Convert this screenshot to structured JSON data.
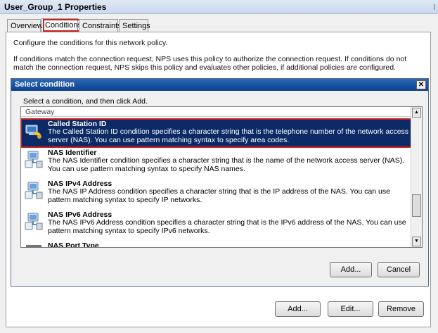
{
  "window": {
    "title": "User_Group_1 Properties",
    "edge_glyph": "⁝"
  },
  "tabs": [
    {
      "label": "Overview",
      "active": false
    },
    {
      "label": "Conditions",
      "active": true
    },
    {
      "label": "Constraints",
      "active": false
    },
    {
      "label": "Settings",
      "active": false
    }
  ],
  "conditions_page": {
    "intro": "Configure the conditions for this network policy.",
    "explanation": "If conditions match the connection request, NPS uses this policy to authorize the connection request. If conditions do not match the connection request, NPS skips this policy and evaluates other policies, if additional policies are configured.",
    "buttons": {
      "add": "Add...",
      "edit": "Edit...",
      "remove": "Remove"
    }
  },
  "dialog": {
    "title": "Select condition",
    "close_glyph": "✕",
    "instruction": "Select a condition, and then click Add.",
    "group_header": "Gateway",
    "items": [
      {
        "title": "Called Station ID",
        "description": "The Called Station ID condition specifies a character string that is the telephone number of the network access server (NAS). You can use pattern matching syntax to specify area codes.",
        "icon": "phone-computer-icon",
        "selected": true
      },
      {
        "title": "NAS Identifier",
        "description": "The NAS Identifier condition specifies a character string that is the name of the network access server (NAS). You can use pattern matching syntax to specify NAS names.",
        "icon": "network-server-icon",
        "selected": false
      },
      {
        "title": "NAS IPv4 Address",
        "description": "The NAS IP Address condition specifies a character string that is the IP address of the NAS. You can use pattern matching syntax to specify IP networks.",
        "icon": "network-server-icon",
        "selected": false
      },
      {
        "title": "NAS IPv6 Address",
        "description": "The NAS IPv6 Address condition specifies a character string that is the IPv6 address of the NAS. You can use pattern matching syntax to specify IPv6 networks.",
        "icon": "network-server-icon",
        "selected": false
      },
      {
        "title": "NAS Port Type",
        "description": "",
        "icon": "port-stack-icon",
        "selected": false
      }
    ],
    "buttons": {
      "add": "Add...",
      "cancel": "Cancel"
    },
    "scroll": {
      "up_glyph": "▲",
      "down_glyph": "▼",
      "position": 0.8
    }
  },
  "colors": {
    "selection": "#0b2a66",
    "highlight_outline": "#d21f1f",
    "dialog_title": "#0b3f8d"
  }
}
